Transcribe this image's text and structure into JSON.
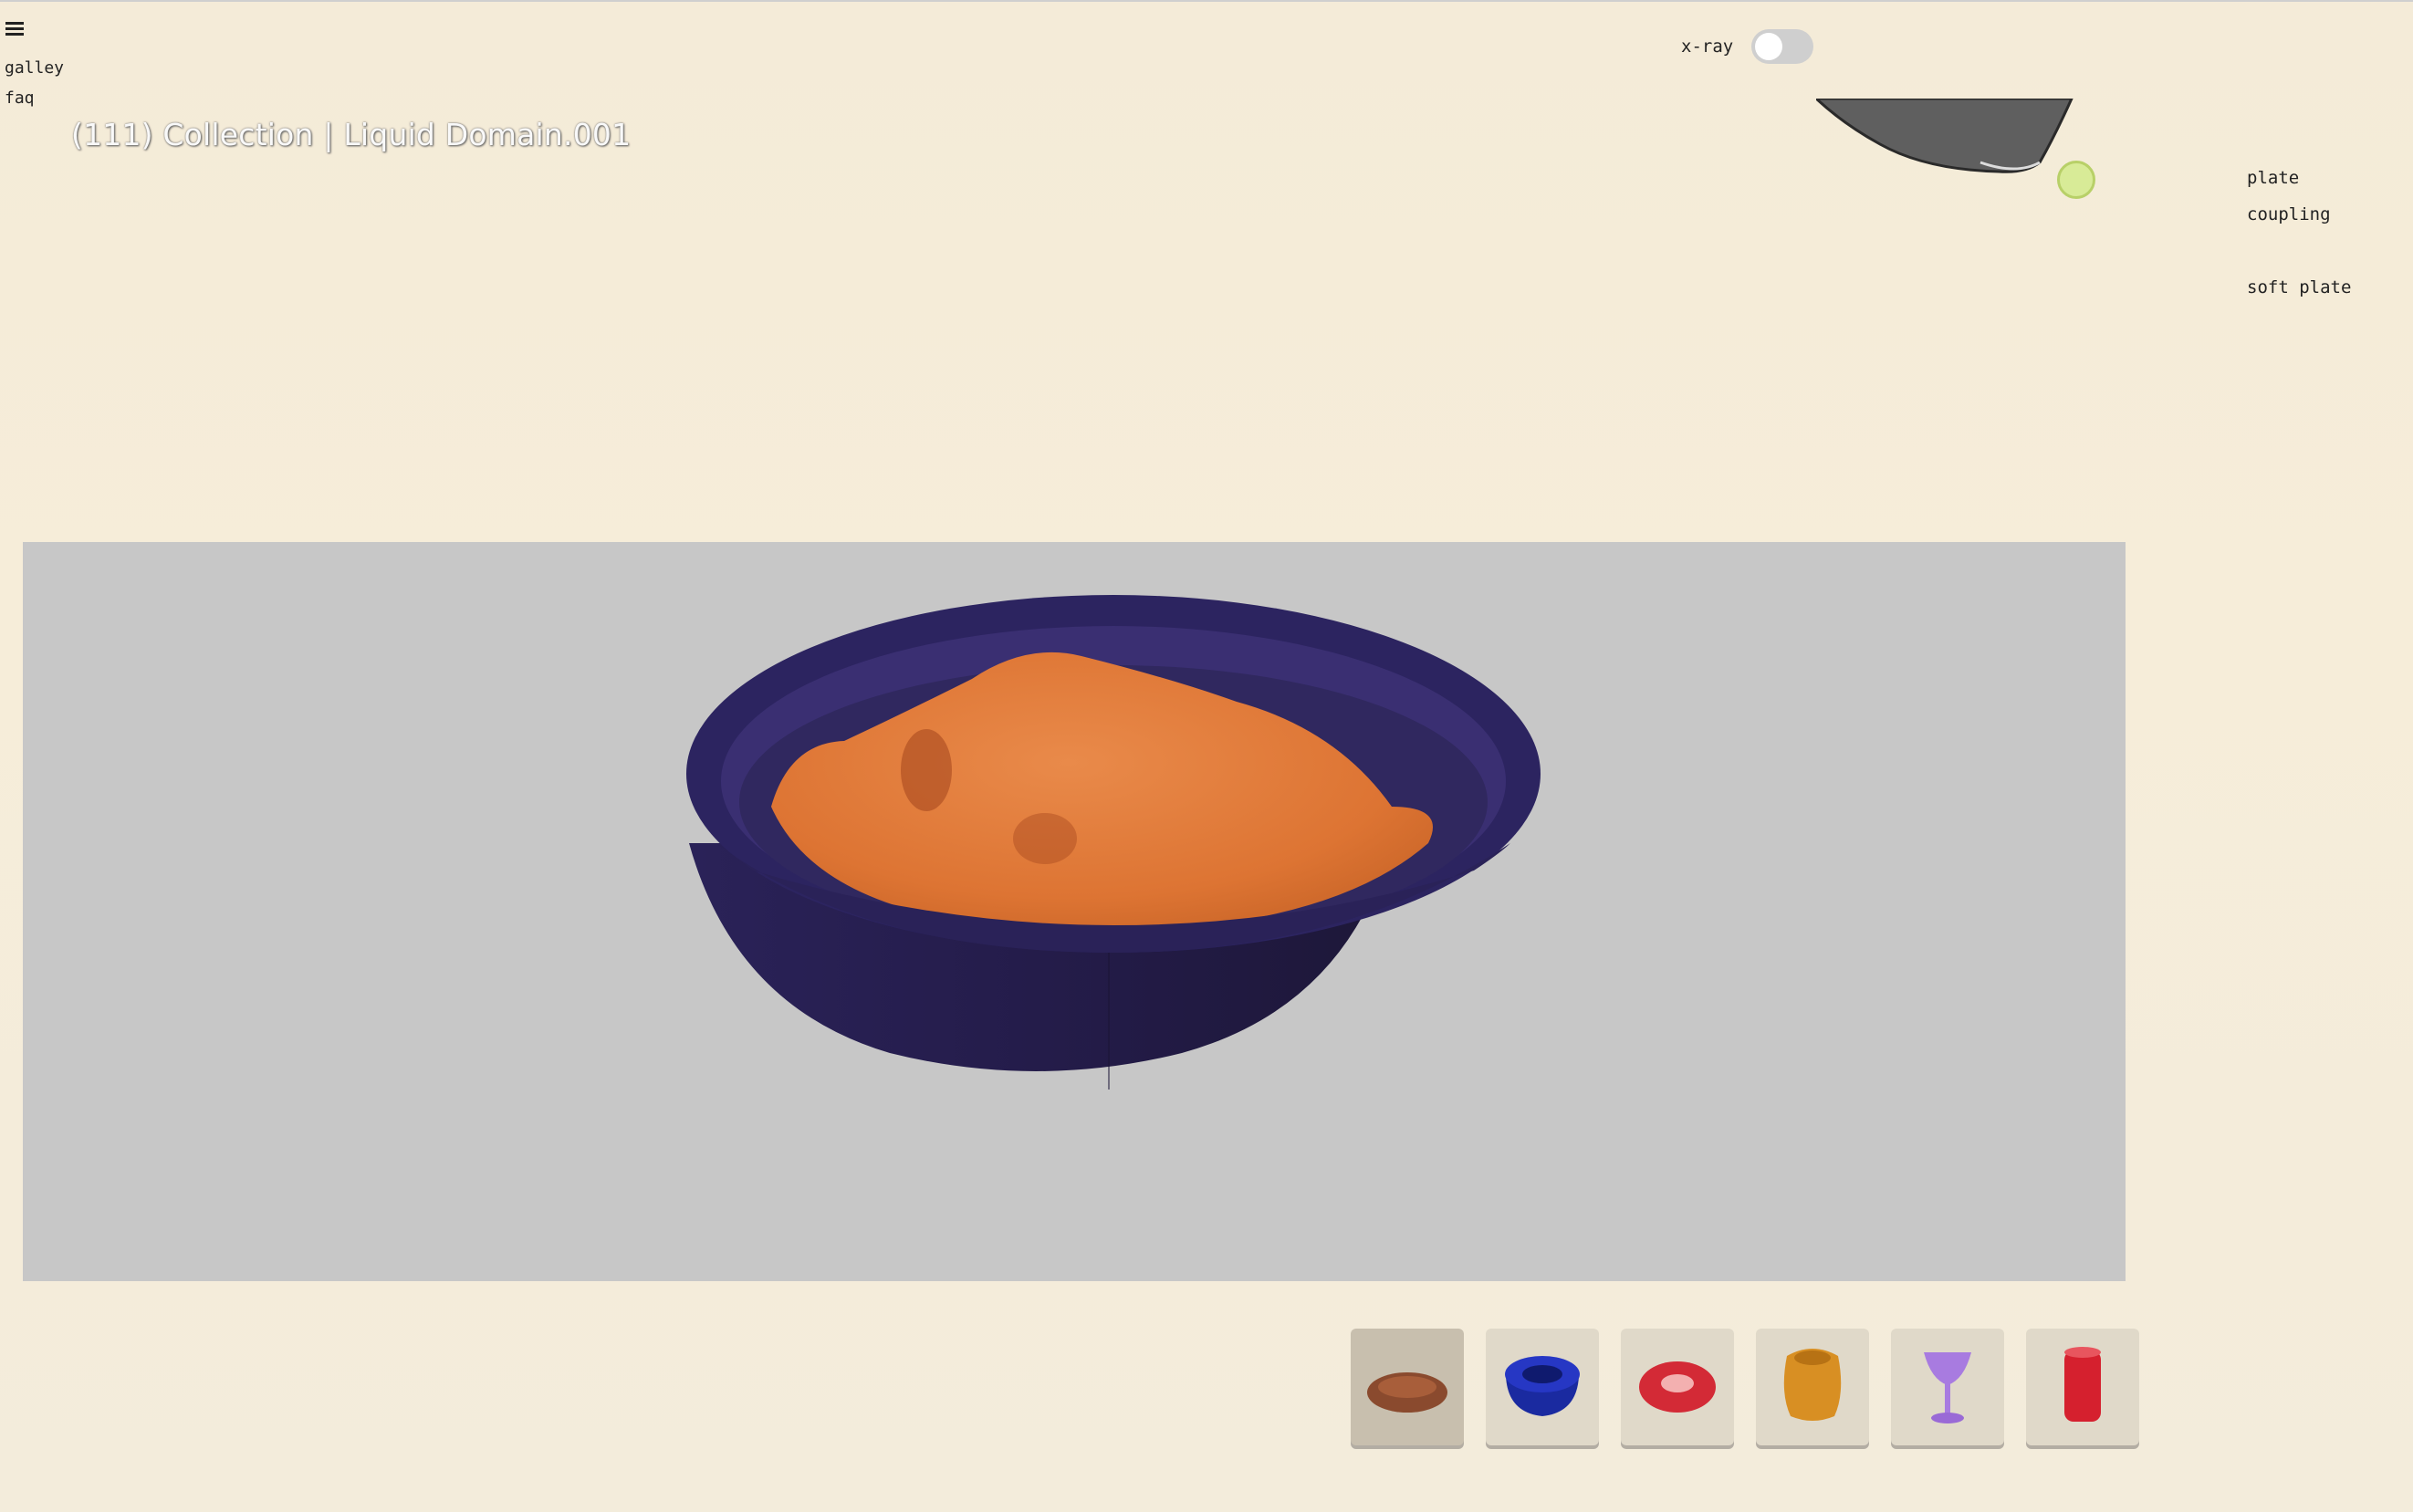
{
  "nav": {
    "menu_icon": "hamburger-icon",
    "links": [
      "galley",
      "faq"
    ]
  },
  "scene": {
    "subtitle": "........",
    "title": "(111) Collection | Liquid Domain.001"
  },
  "xray": {
    "label": "x-ray",
    "enabled": false
  },
  "right_menu": {
    "items": [
      "plate",
      "coupling",
      "soft plate"
    ]
  },
  "viewport": {
    "background": "#c7c7c7",
    "bowl_color": "#2e2560",
    "liquid_color": "#e0773a"
  },
  "thumbnails": [
    {
      "name": "brown-plate-icon",
      "color": "#8a4a2e",
      "selected": true
    },
    {
      "name": "blue-pot-icon",
      "color": "#1e2fa0",
      "selected": false
    },
    {
      "name": "red-ring-icon",
      "color": "#d32a36",
      "selected": false
    },
    {
      "name": "orange-jar-icon",
      "color": "#d88f23",
      "selected": false
    },
    {
      "name": "purple-glass-icon",
      "color": "#a87be0",
      "selected": false
    },
    {
      "name": "red-cylinder-icon",
      "color": "#d5202e",
      "selected": false
    }
  ],
  "colors": {
    "background": "#f3ecdb",
    "status_dot": "#d8eb97"
  }
}
